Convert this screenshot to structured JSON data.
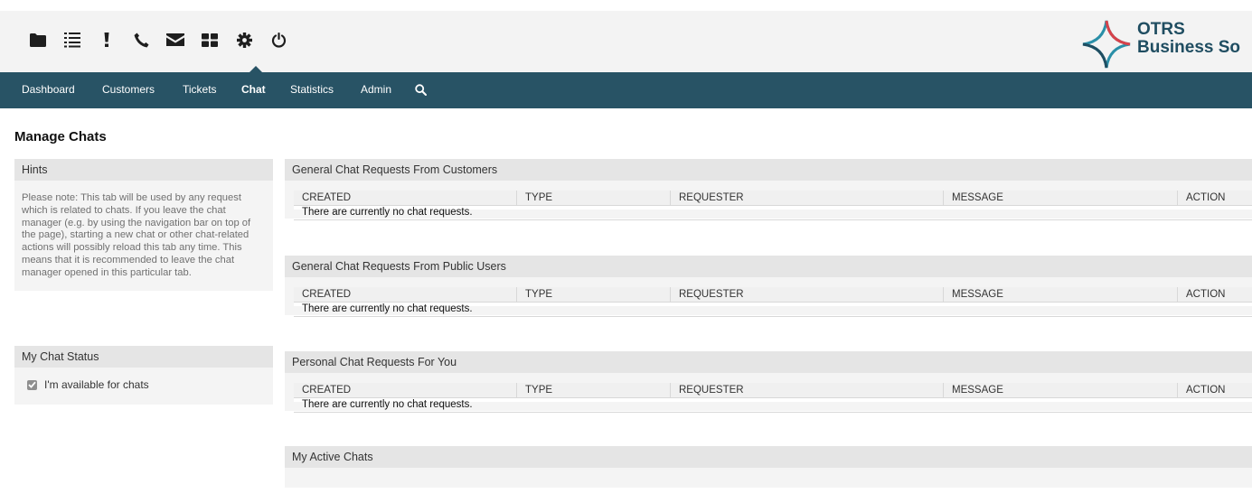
{
  "toolbar": {
    "icons": [
      {
        "icon": "folder-icon",
        "label": "Tickets"
      },
      {
        "icon": "list-icon",
        "label": "Queue view"
      },
      {
        "icon": "exclamation-icon",
        "label": "Escalations"
      },
      {
        "icon": "phone-icon",
        "label": "Phone ticket"
      },
      {
        "icon": "envelope-icon",
        "label": "Email ticket"
      },
      {
        "icon": "grid-icon",
        "label": "Dashboard"
      },
      {
        "icon": "gear-icon",
        "label": "Settings"
      },
      {
        "icon": "power-icon",
        "label": "Logout"
      }
    ]
  },
  "logo": {
    "line1": "OTRS",
    "line2": "Business So",
    "colors": {
      "teal": "#2a8fa8",
      "red": "#d6424a",
      "dark": "#1f4d61"
    }
  },
  "nav": {
    "items": [
      "Dashboard",
      "Customers",
      "Tickets",
      "Chat",
      "Statistics",
      "Admin"
    ],
    "selected": "Chat",
    "background": "#285365"
  },
  "page": {
    "title": "Manage Chats"
  },
  "hints": {
    "title": "Hints",
    "text": "Please note: This tab will be used by any request which is related to chats. If you leave the chat manager (e.g. by using the navigation bar on top of the page), starting a new chat or other chat-related actions will possibly reload this tab any time. This means that it is recommended to leave the chat manager opened in this particular tab."
  },
  "status": {
    "title": "My Chat Status",
    "checkbox_label": "I'm available for chats",
    "checked": true
  },
  "columns": [
    "CREATED",
    "TYPE",
    "REQUESTER",
    "MESSAGE",
    "ACTION"
  ],
  "sections": [
    {
      "title": "General Chat Requests From Customers",
      "empty_text": "There are currently no chat requests."
    },
    {
      "title": "General Chat Requests From Public Users",
      "empty_text": "There are currently no chat requests."
    },
    {
      "title": "Personal Chat Requests For You",
      "empty_text": "There are currently no chat requests."
    }
  ],
  "active_chats": {
    "title": "My Active Chats"
  }
}
